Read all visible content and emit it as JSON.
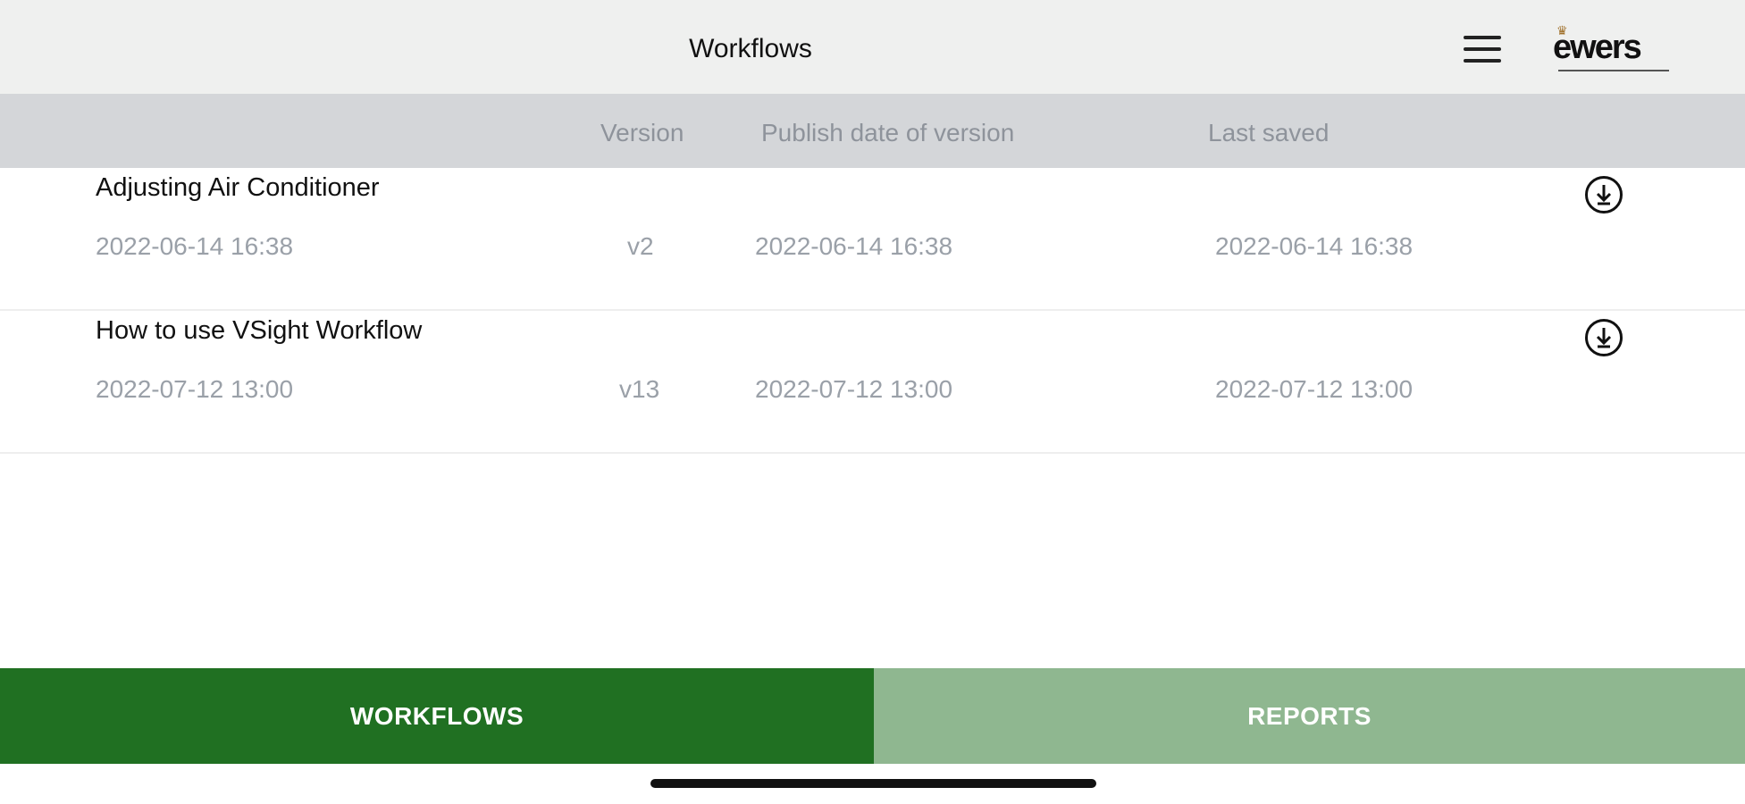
{
  "header": {
    "title": "Workflows",
    "menu_icon": "hamburger-menu-icon",
    "logo_text": "ewers"
  },
  "columns": {
    "version": "Version",
    "publish_date": "Publish date of version",
    "last_saved": "Last saved"
  },
  "workflows": [
    {
      "title": "Adjusting Air Conditioner",
      "created": "2022-06-14 16:38",
      "version": "v2",
      "publish_date": "2022-06-14 16:38",
      "last_saved": "2022-06-14 16:38",
      "action_icon": "download-icon"
    },
    {
      "title": "How to use VSight Workflow",
      "created": "2022-07-12 13:00",
      "version": "v13",
      "publish_date": "2022-07-12 13:00",
      "last_saved": "2022-07-12 13:00",
      "action_icon": "download-icon"
    }
  ],
  "tabs": [
    {
      "label": "WORKFLOWS",
      "active": true
    },
    {
      "label": "REPORTS",
      "active": false
    }
  ],
  "colors": {
    "header_bg": "#eff0ef",
    "column_header_bg": "#d4d6d9",
    "tab_active": "#207022",
    "tab_inactive": "#8fb790",
    "muted_text": "#9aa0a8"
  }
}
